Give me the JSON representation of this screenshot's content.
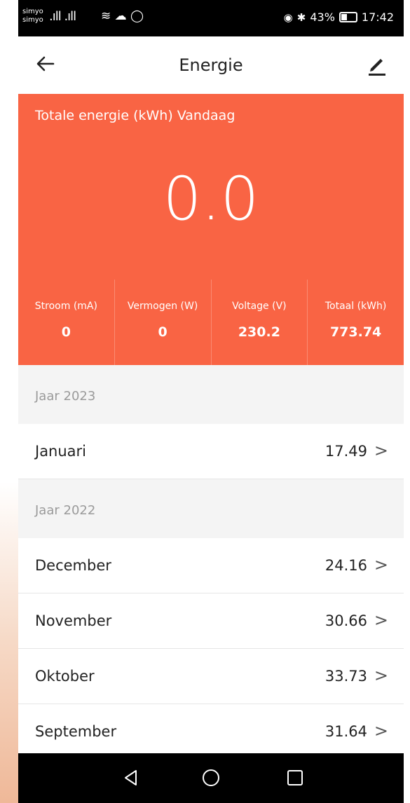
{
  "statusbar": {
    "carrier_line1": "simyo",
    "carrier_line2": "simyo",
    "signal_glyphs": ".ıll .ıll",
    "misc_glyphs": "≋ ☁ ◯",
    "battery_pct": "43%",
    "time": "17:42",
    "icons": [
      "signal-icon",
      "wifi-icon",
      "cloud-icon",
      "whatsapp-icon",
      "eye-icon",
      "bluetooth-icon",
      "battery-icon"
    ]
  },
  "appbar": {
    "title": "Energie",
    "back_icon": "arrow-left-icon",
    "edit_icon": "pencil-icon"
  },
  "hero": {
    "label": "Totale energie (kWh) Vandaag",
    "value": "0.0",
    "accent_color": "#f96444",
    "stats": [
      {
        "label": "Stroom (mA)",
        "value": "0"
      },
      {
        "label": "Vermogen (W)",
        "value": "0"
      },
      {
        "label": "Voltage (V)",
        "value": "230.2"
      },
      {
        "label": "Totaal (kWh)",
        "value": "773.74"
      }
    ]
  },
  "list": {
    "sections": [
      {
        "header": "Jaar 2023",
        "rows": [
          {
            "month": "Januari",
            "value": "17.49"
          }
        ]
      },
      {
        "header": "Jaar 2022",
        "rows": [
          {
            "month": "December",
            "value": "24.16"
          },
          {
            "month": "November",
            "value": "30.66"
          },
          {
            "month": "Oktober",
            "value": "33.73"
          },
          {
            "month": "September",
            "value": "31.64"
          }
        ]
      }
    ],
    "chevron": ">"
  },
  "navbar": {
    "icons": [
      "back-triangle-icon",
      "home-circle-icon",
      "recents-square-icon"
    ]
  }
}
